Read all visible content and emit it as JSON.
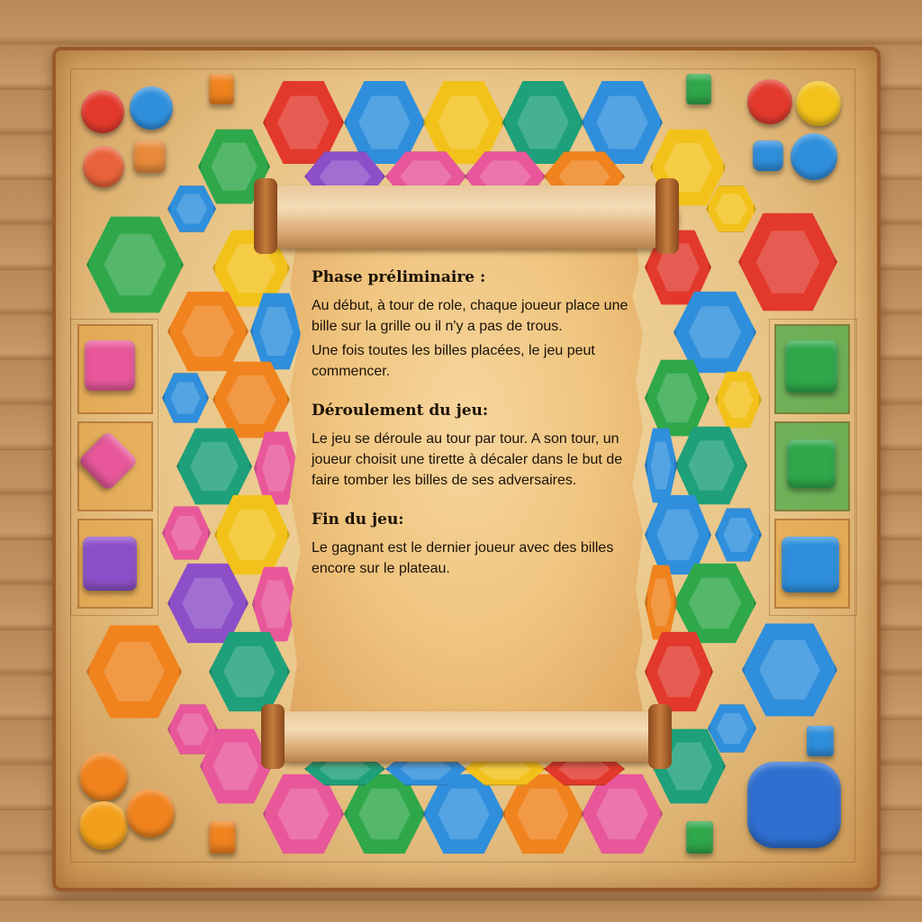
{
  "scroll": {
    "sections": [
      {
        "heading": "Phase préliminaire :",
        "paragraphs": [
          "Au début, à tour de role, chaque joueur place une bille sur la grille ou il n'y a pas de trous.",
          "Une fois toutes les billes placées, le jeu peut commencer."
        ]
      },
      {
        "heading": "Déroulement du jeu:",
        "paragraphs": [
          "Le jeu se déroule au tour par tour. A son tour, un joueur choisit une tirette à décaler dans le but de faire tomber les billes de ses adversaires."
        ]
      },
      {
        "heading": "Fin du jeu:",
        "paragraphs": [
          "Le gagnant est le dernier joueur avec des billes encore sur le plateau."
        ]
      }
    ]
  },
  "colors": {
    "red": "#e2392c",
    "blue": "#2f8fdc",
    "yellow": "#f2c21b",
    "green": "#2fa84a",
    "orange": "#f0831e",
    "pink": "#e8579a",
    "purple": "#8d4fc8",
    "teal": "#1ea07a",
    "board": "#e8c486",
    "parchment": "#efc47e"
  }
}
